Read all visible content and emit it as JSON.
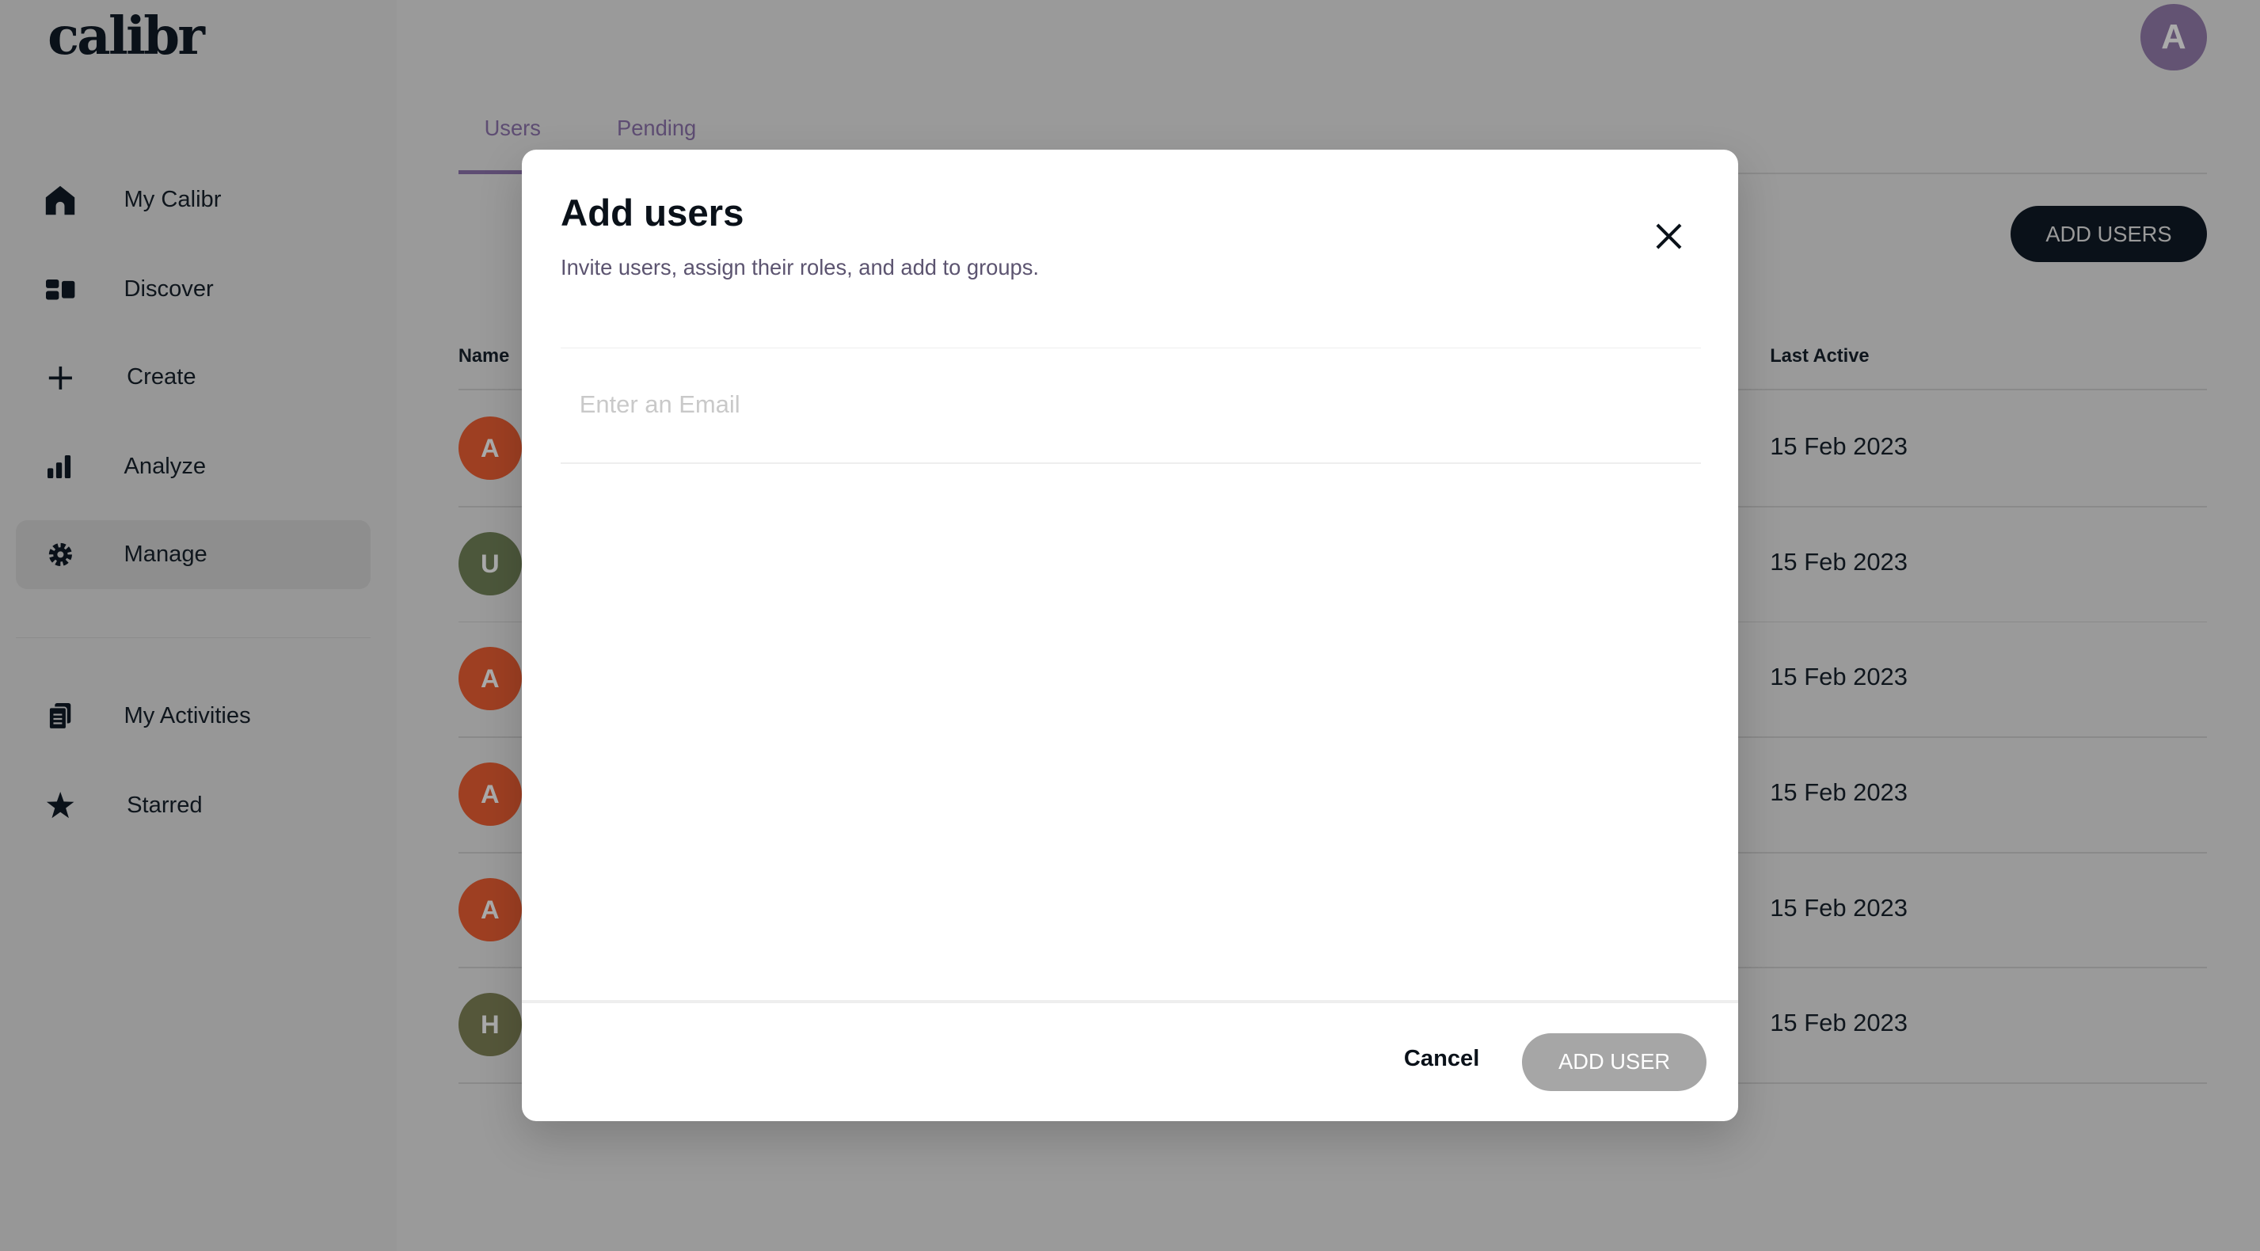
{
  "app": {
    "logo": "calibr",
    "user_initial": "A"
  },
  "sidebar": {
    "items": [
      {
        "label": "My Calibr",
        "icon": "home-icon"
      },
      {
        "label": "Discover",
        "icon": "discover-icon"
      },
      {
        "label": "Create",
        "icon": "plus-icon"
      },
      {
        "label": "Analyze",
        "icon": "bar-chart-icon"
      },
      {
        "label": "Manage",
        "icon": "gear-icon",
        "selected": true
      },
      {
        "label": "My Activities",
        "icon": "clipboard-icon"
      },
      {
        "label": "Starred",
        "icon": "star-icon"
      }
    ]
  },
  "main": {
    "tabs": [
      {
        "label": "Users",
        "active": true
      },
      {
        "label": "Pending"
      }
    ],
    "add_users_label": "ADD USERS",
    "columns": {
      "name": "Name",
      "last_active": "Last Active"
    },
    "rows": [
      {
        "initial": "A",
        "color": "#9e3f22",
        "last_active": "15 Feb 2023"
      },
      {
        "initial": "U",
        "color": "#4c573b",
        "last_active": "15 Feb 2023"
      },
      {
        "initial": "A",
        "color": "#9e3f22",
        "last_active": "15 Feb 2023"
      },
      {
        "initial": "A",
        "color": "#9e3f22",
        "last_active": "15 Feb 2023"
      },
      {
        "initial": "A",
        "color": "#9e3f22",
        "last_active": "15 Feb 2023"
      },
      {
        "initial": "H",
        "color": "#55573a",
        "last_active": "15 Feb 2023"
      }
    ]
  },
  "modal": {
    "title": "Add users",
    "subtitle": "Invite users, assign their roles, and add to groups.",
    "email_placeholder": "Enter an Email",
    "email_value": "",
    "cancel_label": "Cancel",
    "add_user_label": "ADD USER"
  },
  "colors": {
    "accent": "#5e4d73",
    "dark": "#0a1119",
    "overlay": "#999999",
    "disabled_button": "#a6a6a6"
  }
}
